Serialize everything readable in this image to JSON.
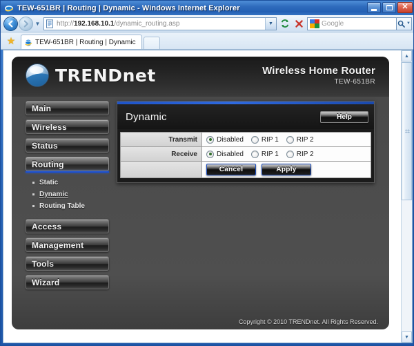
{
  "browser": {
    "title": "TEW-651BR | Routing | Dynamic - Windows Internet Explorer",
    "ie_icon": "internet-explorer-icon",
    "minimize_label": "Minimize",
    "maximize_label": "Maximize",
    "close_label": "Close",
    "back_label": "Back",
    "forward_label": "Forward",
    "history_icon": "chevron-down-icon",
    "address": {
      "favicon": "page-icon",
      "scheme": "http://",
      "host": "192.168.10.1",
      "path": "/dynamic_routing.asp",
      "dropdown_icon": "chevron-down-icon"
    },
    "refresh_icon": "refresh-icon",
    "stop_icon": "stop-icon",
    "search": {
      "provider_icon": "google-icon",
      "placeholder": "Google",
      "go_icon": "magnifier-icon",
      "options_icon": "chevron-down-icon"
    },
    "favorites_icon": "star-icon",
    "tab": {
      "favicon": "internet-explorer-icon",
      "label": "TEW-651BR | Routing | Dynamic"
    },
    "new_tab_label": "",
    "scrollbar": {
      "up_icon": "caret-up-icon",
      "down_icon": "caret-down-icon",
      "grip_icon": "grip-icon"
    }
  },
  "router": {
    "brand": {
      "logo_icon": "trendnet-orb-icon",
      "name_upper": "TREND",
      "name_lower": "net"
    },
    "product": {
      "name": "Wireless Home Router",
      "model": "TEW-651BR"
    },
    "sidebar": {
      "items": [
        {
          "label": "Main",
          "active": false
        },
        {
          "label": "Wireless",
          "active": false
        },
        {
          "label": "Status",
          "active": false
        },
        {
          "label": "Routing",
          "active": true
        },
        {
          "label": "Access",
          "active": false
        },
        {
          "label": "Management",
          "active": false
        },
        {
          "label": "Tools",
          "active": false
        },
        {
          "label": "Wizard",
          "active": false
        }
      ],
      "submenu": [
        {
          "label": "Static",
          "current": false
        },
        {
          "label": "Dynamic",
          "current": true
        },
        {
          "label": "Routing Table",
          "current": false
        }
      ]
    },
    "card": {
      "title": "Dynamic",
      "help_label": "Help",
      "accent_color": "#2f6ae0",
      "rows": [
        {
          "label": "Transmit",
          "options": [
            {
              "label": "Disabled",
              "checked": true
            },
            {
              "label": "RIP 1",
              "checked": false
            },
            {
              "label": "RIP 2",
              "checked": false
            }
          ]
        },
        {
          "label": "Receive",
          "options": [
            {
              "label": "Disabled",
              "checked": true
            },
            {
              "label": "RIP 1",
              "checked": false
            },
            {
              "label": "RIP 2",
              "checked": false
            }
          ]
        }
      ],
      "cancel_label": "Cancel",
      "apply_label": "Apply"
    },
    "footer": {
      "copyright": "Copyright © 2010 TRENDnet. All Rights Reserved."
    }
  }
}
